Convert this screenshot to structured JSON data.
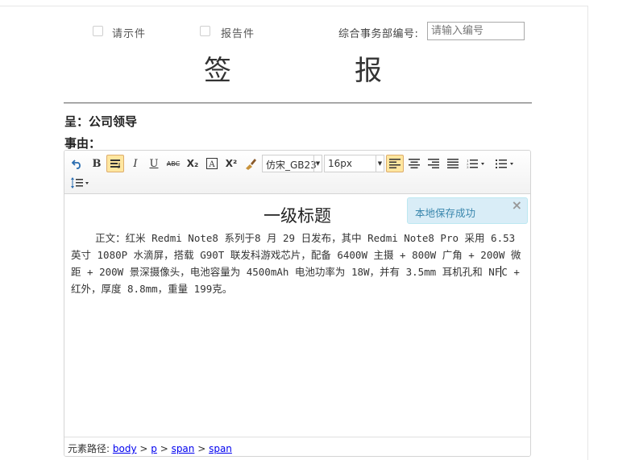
{
  "header": {
    "checkbox1_label": "请示件",
    "checkbox2_label": "报告件",
    "dept_number_label": "综合事务部编号:",
    "dept_number_placeholder": "请输入编号",
    "dept_number_value": ""
  },
  "title": {
    "char1": "签",
    "char2": "报"
  },
  "fields": {
    "to": "呈：公司领导",
    "reason_label": "事由："
  },
  "toolbar": {
    "undo_icon": "undo-icon",
    "bold": "B",
    "italic": "I",
    "underline": "U",
    "strikethrough": "ABC",
    "subscript": "X₂",
    "superscript": "X²",
    "font_family": "仿宋_GB23",
    "font_size": "16px",
    "active_color": "#ffe69f"
  },
  "content": {
    "heading": "一级标题",
    "body_before_caret": "    正文：红米 Redmi Note8 系列于8 月 29 日发布，其中 Redmi Note8 Pro 采用 6.53 英寸 1080P 水滴屏，搭载 G90T 联发科游戏芯片，配备 6400W 主摄 + 800W 广角 + 200W 微距 + 200W 景深摄像头，电池容量为 4500mAh 电池功率为 18W，并有 3.5mm 耳机孔和 NF",
    "body_after_caret": "C + 红外，厚度 8.8mm，重量 199克。"
  },
  "toast": {
    "message": "本地保存成功",
    "close": "×"
  },
  "status_bar": {
    "label": "元素路径:",
    "path": [
      "body",
      "p",
      "span",
      "span"
    ],
    "separator": " > "
  }
}
